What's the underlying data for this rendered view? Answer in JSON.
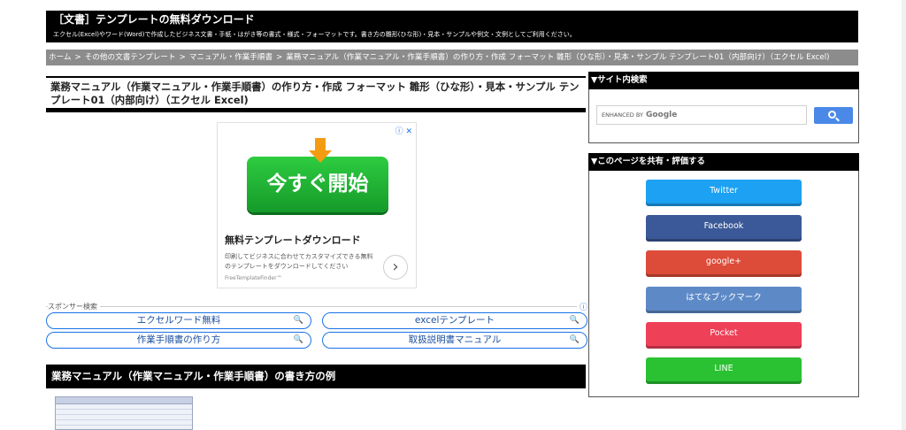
{
  "header": {
    "title": "［文書］テンプレートの無料ダウンロード",
    "description": "エクセル(Excel)やワード(Word)で作成したビジネス文書・手紙・はがき等の書式・様式・フォーマットです。書き方の雛形(ひな形)・見本・サンプルや例文・文例としてご利用ください。"
  },
  "breadcrumb": {
    "separator": ">",
    "items": [
      "ホーム",
      "その他の文書テンプレート",
      "マニュアル・作業手順書",
      "業務マニュアル（作業マニュアル・作業手順書）の作り方・作成 フォーマット 雛形（ひな形）・見本・サンプル テンプレート01（内部向け）（エクセル Excel)"
    ]
  },
  "main": {
    "title": "業務マニュアル（作業マニュアル・作業手順書）の作り方・作成 フォーマット 雛形（ひな形）・見本・サンプル テンプレート01（内部向け）（エクセル Excel)",
    "section_title": "業務マニュアル（作業マニュアル・作業手順書）の書き方の例"
  },
  "ad": {
    "info_icon": "ⓘ ✕",
    "button_label": "今すぐ開始",
    "headline": "無料テンプレートダウンロード",
    "body": "印刷してビジネスに合わせてカスタマイズできる無料のテンプレートをダウンロードしてください",
    "brand": "FreeTemplateFinder™",
    "next_icon": "›"
  },
  "sponsored_search": {
    "label": "スポンサー検索",
    "info_icon": "ⓘ",
    "search_icon": "🔍",
    "links": [
      "エクセルワード無料",
      "excelテンプレート",
      "作業手順書の作り方",
      "取扱説明書マニュアル"
    ]
  },
  "sidebar": {
    "search": {
      "heading": "▼サイト内検索",
      "enhanced_by": "ENHANCED BY",
      "brand": "Google"
    },
    "share": {
      "heading": "▼このページを共有・評価する",
      "buttons": [
        {
          "label": "Twitter",
          "color": "#1da1f2"
        },
        {
          "label": "Facebook",
          "color": "#3b5998"
        },
        {
          "label": "google+",
          "color": "#dd4b39"
        },
        {
          "label": "はてなブックマーク",
          "color": "#5d8ac7"
        },
        {
          "label": "Pocket",
          "color": "#ee4056"
        },
        {
          "label": "LINE",
          "color": "#2ac232"
        }
      ]
    }
  }
}
